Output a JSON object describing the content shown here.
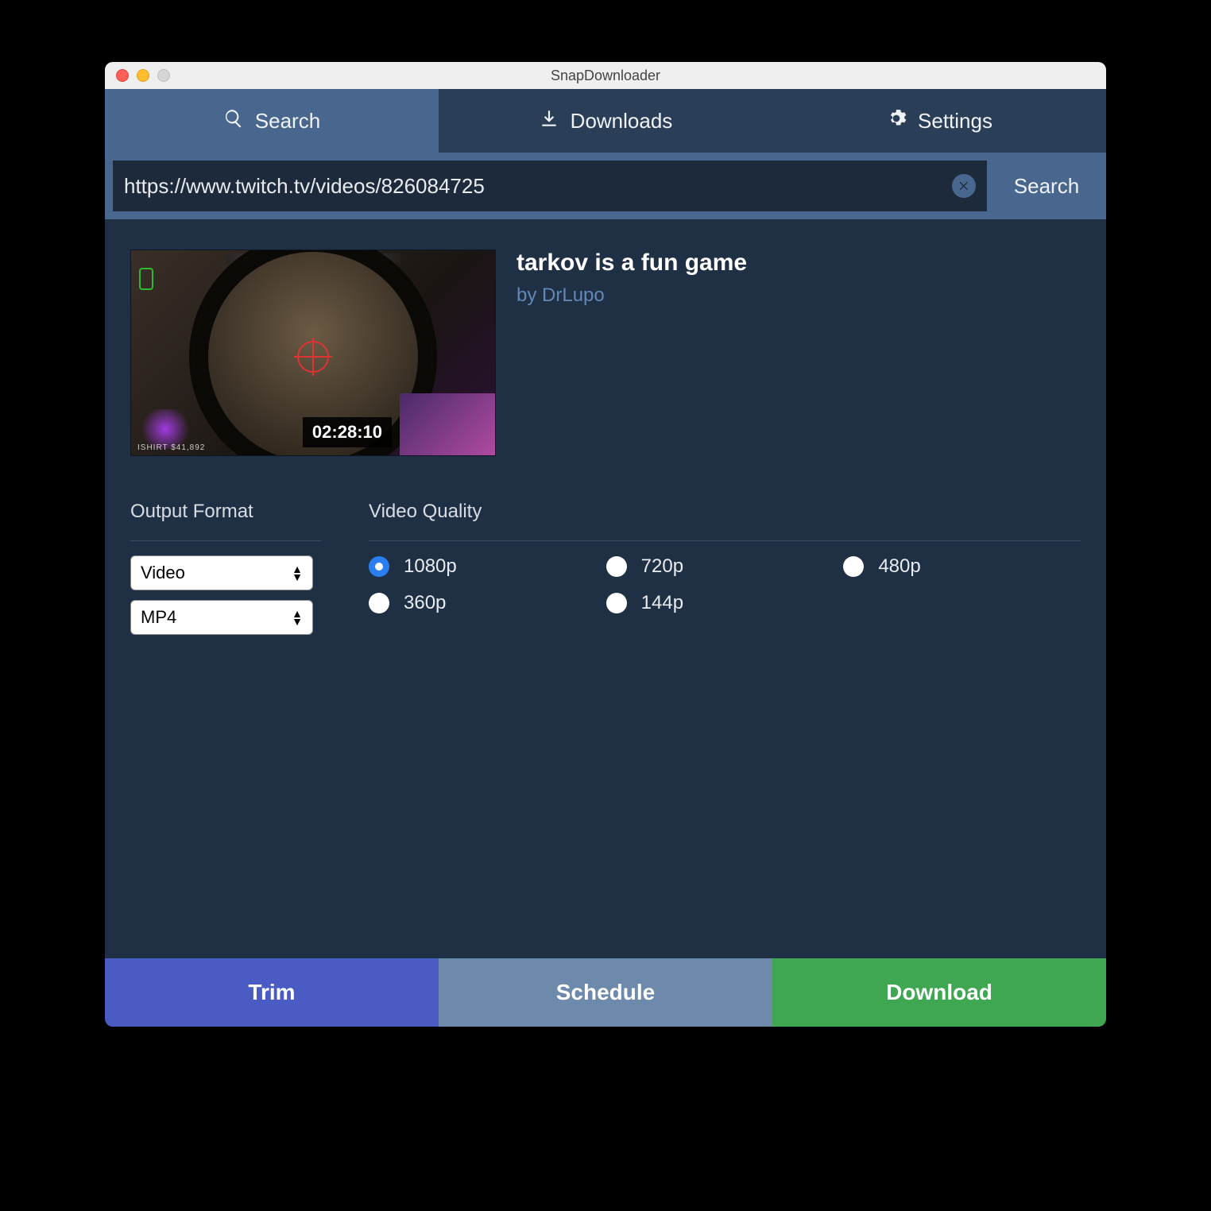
{
  "window": {
    "title": "SnapDownloader"
  },
  "tabs": {
    "search": "Search",
    "downloads": "Downloads",
    "settings": "Settings",
    "active": "search"
  },
  "search": {
    "url_value": "https://www.twitch.tv/videos/826084725",
    "button_label": "Search"
  },
  "video": {
    "title": "tarkov is a fun game",
    "author": "by DrLupo",
    "duration": "02:28:10",
    "hud_text": "ISHIRT  $41,892"
  },
  "format": {
    "section_title": "Output Format",
    "type_value": "Video",
    "container_value": "MP4"
  },
  "quality": {
    "section_title": "Video Quality",
    "options": [
      "1080p",
      "720p",
      "480p",
      "360p",
      "144p"
    ],
    "selected": "1080p"
  },
  "footer": {
    "trim": "Trim",
    "schedule": "Schedule",
    "download": "Download"
  }
}
